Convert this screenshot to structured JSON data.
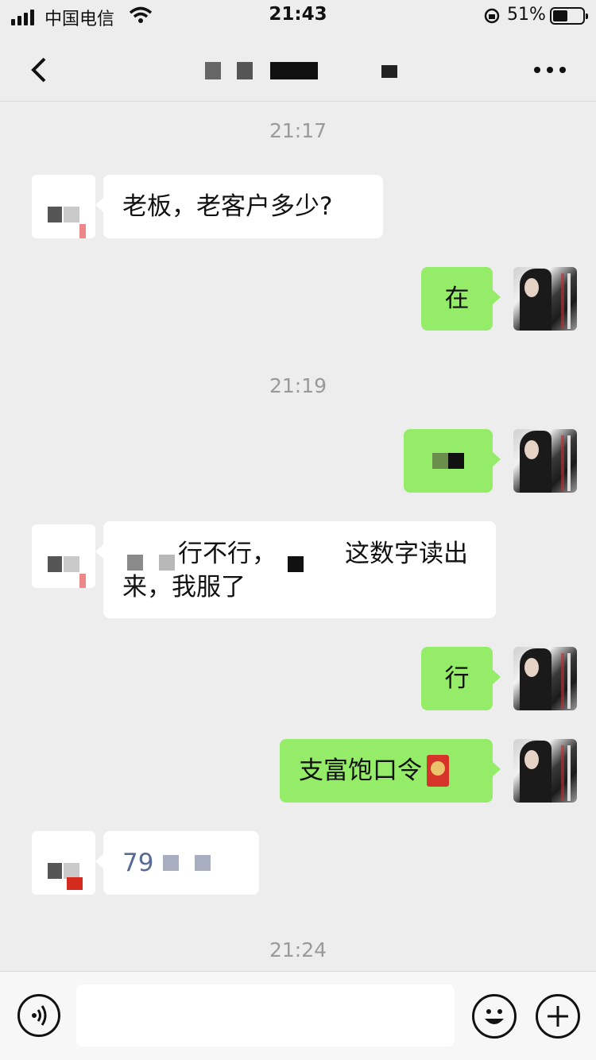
{
  "status_bar": {
    "carrier": "中国电信",
    "time": "21:43",
    "battery_percent": "51%",
    "battery_level": 0.51
  },
  "nav": {
    "back_icon": "chevron-left-icon",
    "title_redacted": true,
    "more_icon": "more-horizontal-icon"
  },
  "timestamps": [
    "21:17",
    "21:19",
    "21:24"
  ],
  "messages": {
    "m1": "老板，老客户多少?",
    "m2": "在",
    "m4_a": "行不行，",
    "m4_b": "这数字读出",
    "m4_c": "来，我服了",
    "m5": "行",
    "m6": "支富饱口令",
    "m7": "79"
  },
  "icons": {
    "voice": "voice-icon",
    "emoji": "emoji-icon",
    "plus": "plus-icon",
    "red_packet": "red-packet-icon"
  },
  "colors": {
    "background": "#ededed",
    "outgoing_bubble": "#95ec69",
    "incoming_bubble": "#ffffff",
    "link_text": "#576b95"
  }
}
